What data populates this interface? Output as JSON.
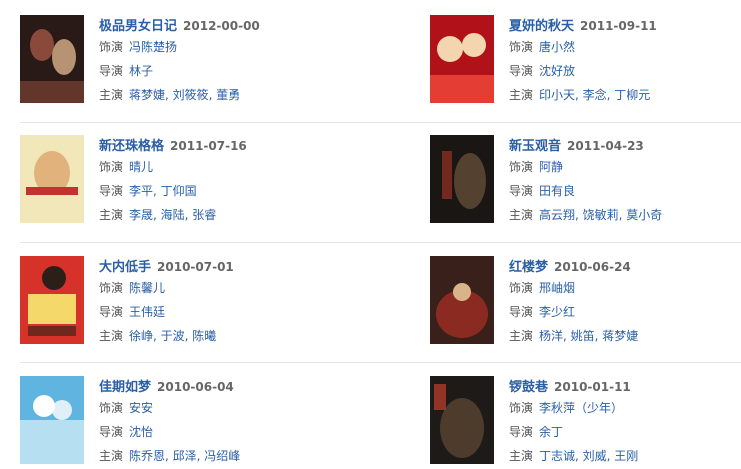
{
  "labels": {
    "role": "饰演",
    "director": "导演",
    "cast": "主演"
  },
  "items": [
    {
      "title": "极品男女日记",
      "date": "2012-00-00",
      "role": "冯陈楚扬",
      "director": "林子",
      "cast": "蒋梦婕, 刘筱筱, 董勇",
      "poster_colors": [
        "#2a1a17",
        "#8a4a3b",
        "#d9b28a"
      ]
    },
    {
      "title": "夏妍的秋天",
      "date": "2011-09-11",
      "role": "唐小然",
      "director": "沈好放",
      "cast": "印小天, 李念, 丁柳元",
      "poster_colors": [
        "#b1121a",
        "#e43d33",
        "#f3d5b0"
      ]
    },
    {
      "title": "新还珠格格",
      "date": "2011-07-16",
      "role": "晴儿",
      "director": "李平, 丁仰国",
      "cast": "李晟, 海陆, 张睿",
      "poster_colors": [
        "#f2e7b9",
        "#e1b27c",
        "#c2322e"
      ]
    },
    {
      "title": "新玉观音",
      "date": "2011-04-23",
      "role": "阿静",
      "director": "田有良",
      "cast": "高云翔, 饶敏莉, 莫小奇",
      "poster_colors": [
        "#1a1614",
        "#54412f",
        "#8a3021"
      ]
    },
    {
      "title": "大内低手",
      "date": "2010-07-01",
      "role": "陈馨儿",
      "director": "王伟廷",
      "cast": "徐峥, 于波, 陈曦",
      "poster_colors": [
        "#d6322a",
        "#f4d86a",
        "#2c1f18"
      ]
    },
    {
      "title": "红楼梦",
      "date": "2010-06-24",
      "role": "邢岫烟",
      "director": "李少红",
      "cast": "杨洋, 姚笛, 蒋梦婕",
      "poster_colors": [
        "#3a201a",
        "#8b2a21",
        "#d9b38a"
      ]
    },
    {
      "title": "佳期如梦",
      "date": "2010-06-04",
      "role": "安安",
      "director": "沈怡",
      "cast": "陈乔恩, 邱泽, 冯绍峰",
      "poster_colors": [
        "#5fb4e0",
        "#b6dff2",
        "#ffffff"
      ]
    },
    {
      "title": "锣鼓巷",
      "date": "2010-01-11",
      "role": "李秋萍（少年）",
      "director": "余丁",
      "cast": "丁志诚, 刘威, 王刚",
      "poster_colors": [
        "#1d1a18",
        "#4d3b2c",
        "#a6382a"
      ]
    }
  ]
}
